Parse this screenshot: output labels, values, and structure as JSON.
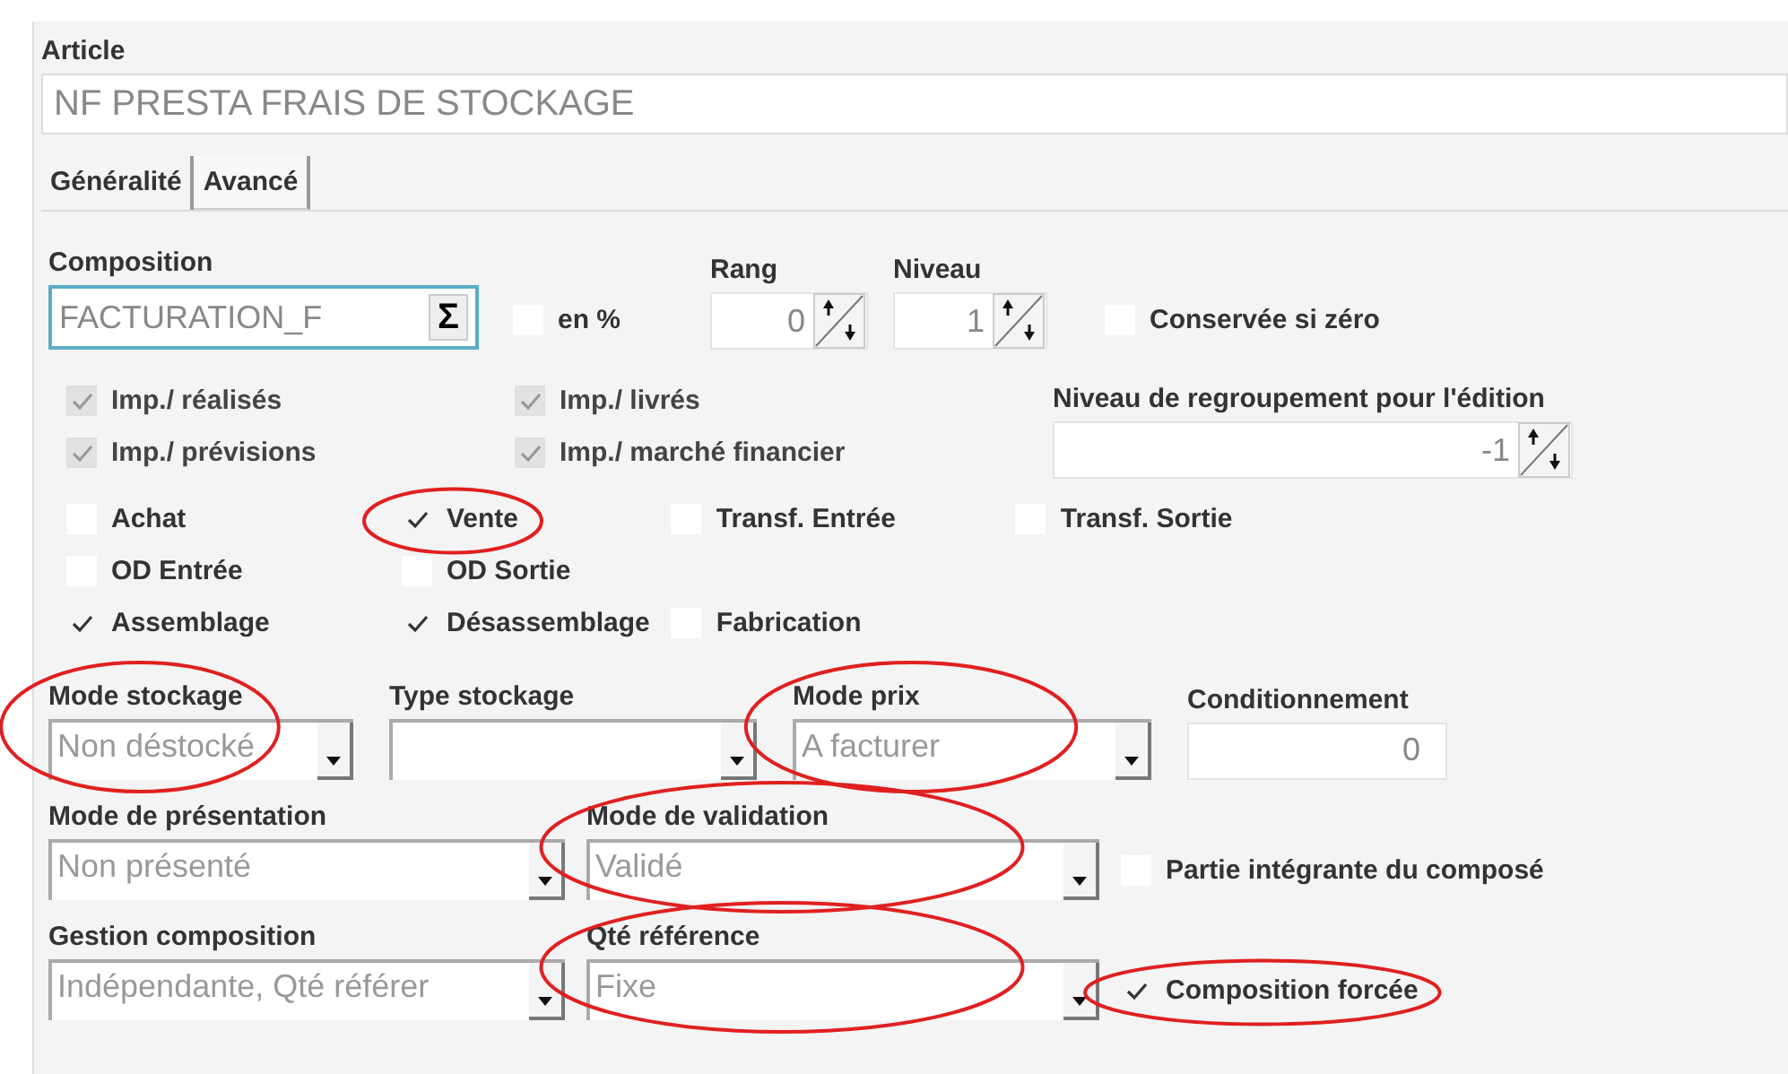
{
  "article": {
    "label": "Article",
    "value": "NF PRESTA FRAIS DE STOCKAGE"
  },
  "tabs": [
    {
      "label": "Généralité",
      "selected": true
    },
    {
      "label": "Avancé",
      "selected": false
    }
  ],
  "composition": {
    "label": "Composition",
    "value": "FACTURATION_F",
    "button": "Σ"
  },
  "en_pourcent": {
    "label": "en %",
    "checked": false
  },
  "rang": {
    "label": "Rang",
    "value": "0"
  },
  "niveau": {
    "label": "Niveau",
    "value": "1"
  },
  "conservee": {
    "label": "Conservée si zéro",
    "checked": false
  },
  "imputations": [
    {
      "label": "Imp./ réalisés",
      "checked": true,
      "disabled": true
    },
    {
      "label": "Imp./ livrés",
      "checked": true,
      "disabled": true
    },
    {
      "label": "Imp./ prévisions",
      "checked": true,
      "disabled": true
    },
    {
      "label": "Imp./ marché financier",
      "checked": true,
      "disabled": true
    }
  ],
  "regroupement": {
    "label": "Niveau de regroupement pour l'édition",
    "value": "-1"
  },
  "flag_rows": [
    [
      {
        "label": "Achat",
        "checked": false,
        "circled": false
      },
      {
        "label": "Vente",
        "checked": true,
        "circled": true
      },
      {
        "label": "Transf. Entrée",
        "checked": false,
        "circled": false
      },
      {
        "label": "Transf. Sortie",
        "checked": false,
        "circled": false
      }
    ],
    [
      {
        "label": "OD Entrée",
        "checked": false,
        "circled": false
      },
      {
        "label": "OD Sortie",
        "checked": false,
        "circled": false
      }
    ],
    [
      {
        "label": "Assemblage",
        "checked": true,
        "circled": false
      },
      {
        "label": "Désassemblage",
        "checked": true,
        "circled": false
      },
      {
        "label": "Fabrication",
        "checked": false,
        "circled": false
      }
    ]
  ],
  "rows": [
    [
      {
        "kind": "dropdown",
        "label": "Mode stockage",
        "value": "Non déstocké",
        "circled": true
      },
      {
        "kind": "dropdown",
        "label": "Type stockage",
        "circled": false
      },
      {
        "kind": "dropdown",
        "label": "Mode prix",
        "value": "A facturer",
        "circled": true
      },
      {
        "kind": "number",
        "label": "Conditionnement",
        "value": "0",
        "circled": false
      }
    ],
    [
      {
        "kind": "dropdown",
        "label": "Mode de présentation",
        "value": "Non présenté",
        "circled": false
      },
      {
        "kind": "dropdown",
        "label": "Mode de validation",
        "value": "Validé",
        "circled": true
      },
      {
        "kind": "checkbox",
        "label": "Partie intégrante du composé",
        "checked": false,
        "circled": false
      }
    ],
    [
      {
        "kind": "dropdown",
        "label": "Gestion composition",
        "value": "Indépendante, Qté référer",
        "circled": false
      },
      {
        "kind": "dropdown",
        "label": "Qté référence",
        "value": "Fixe",
        "circled": true
      },
      {
        "kind": "checkbox",
        "label": "Composition forcée",
        "checked": true,
        "circled": true
      }
    ]
  ]
}
